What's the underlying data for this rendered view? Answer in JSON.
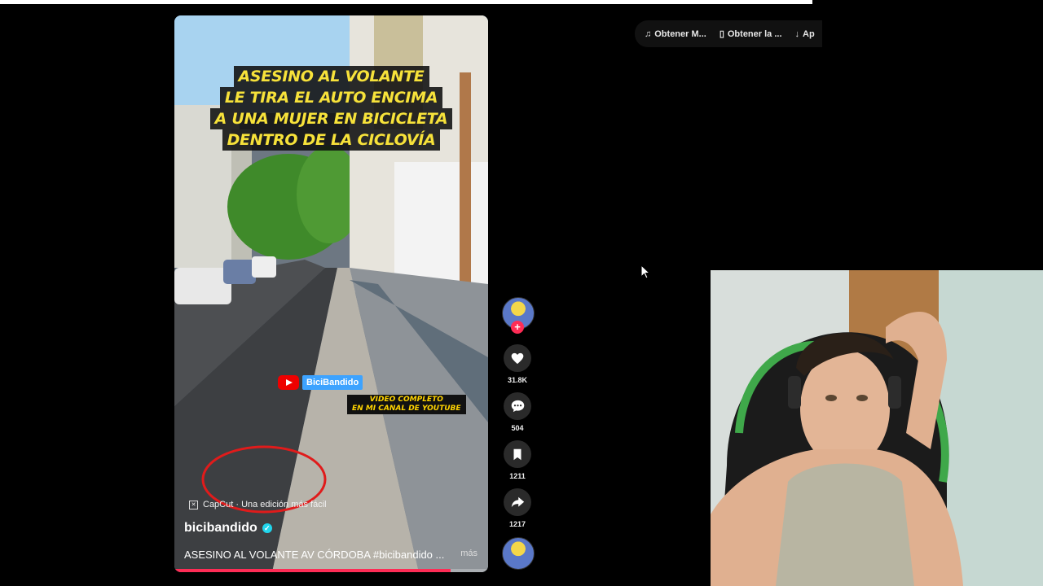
{
  "video": {
    "headline_lines": [
      "ASESINO AL VOLANTE",
      "LE TIRA EL AUTO ENCIMA",
      "A UNA MUJER EN BICICLETA",
      "DENTRO DE LA CICLOVÍA"
    ],
    "youtube_channel": "BiciBandido",
    "promo_line1": "VIDEO COMPLETO",
    "promo_line2": "EN MI CANAL DE YOUTUBE",
    "capcut_label": "CapCut · Una edición más fácil",
    "username": "bicibandido",
    "caption": "ASESINO AL VOLANTE AV CÓRDOBA #bicibandido ...",
    "more_label": "más",
    "progress": 0.88
  },
  "rail": {
    "like_count": "31.8K",
    "comment_count": "504",
    "save_count": "1211",
    "share_count": "1217",
    "follow_icon": "plus-icon"
  },
  "toolbar": {
    "item1": "Obtener M...",
    "item2": "Obtener la ...",
    "item3": "Ap"
  },
  "colors": {
    "accent": "#fe2c55",
    "headline_yellow": "#f7e23a",
    "youtube_red": "#ee0000"
  }
}
